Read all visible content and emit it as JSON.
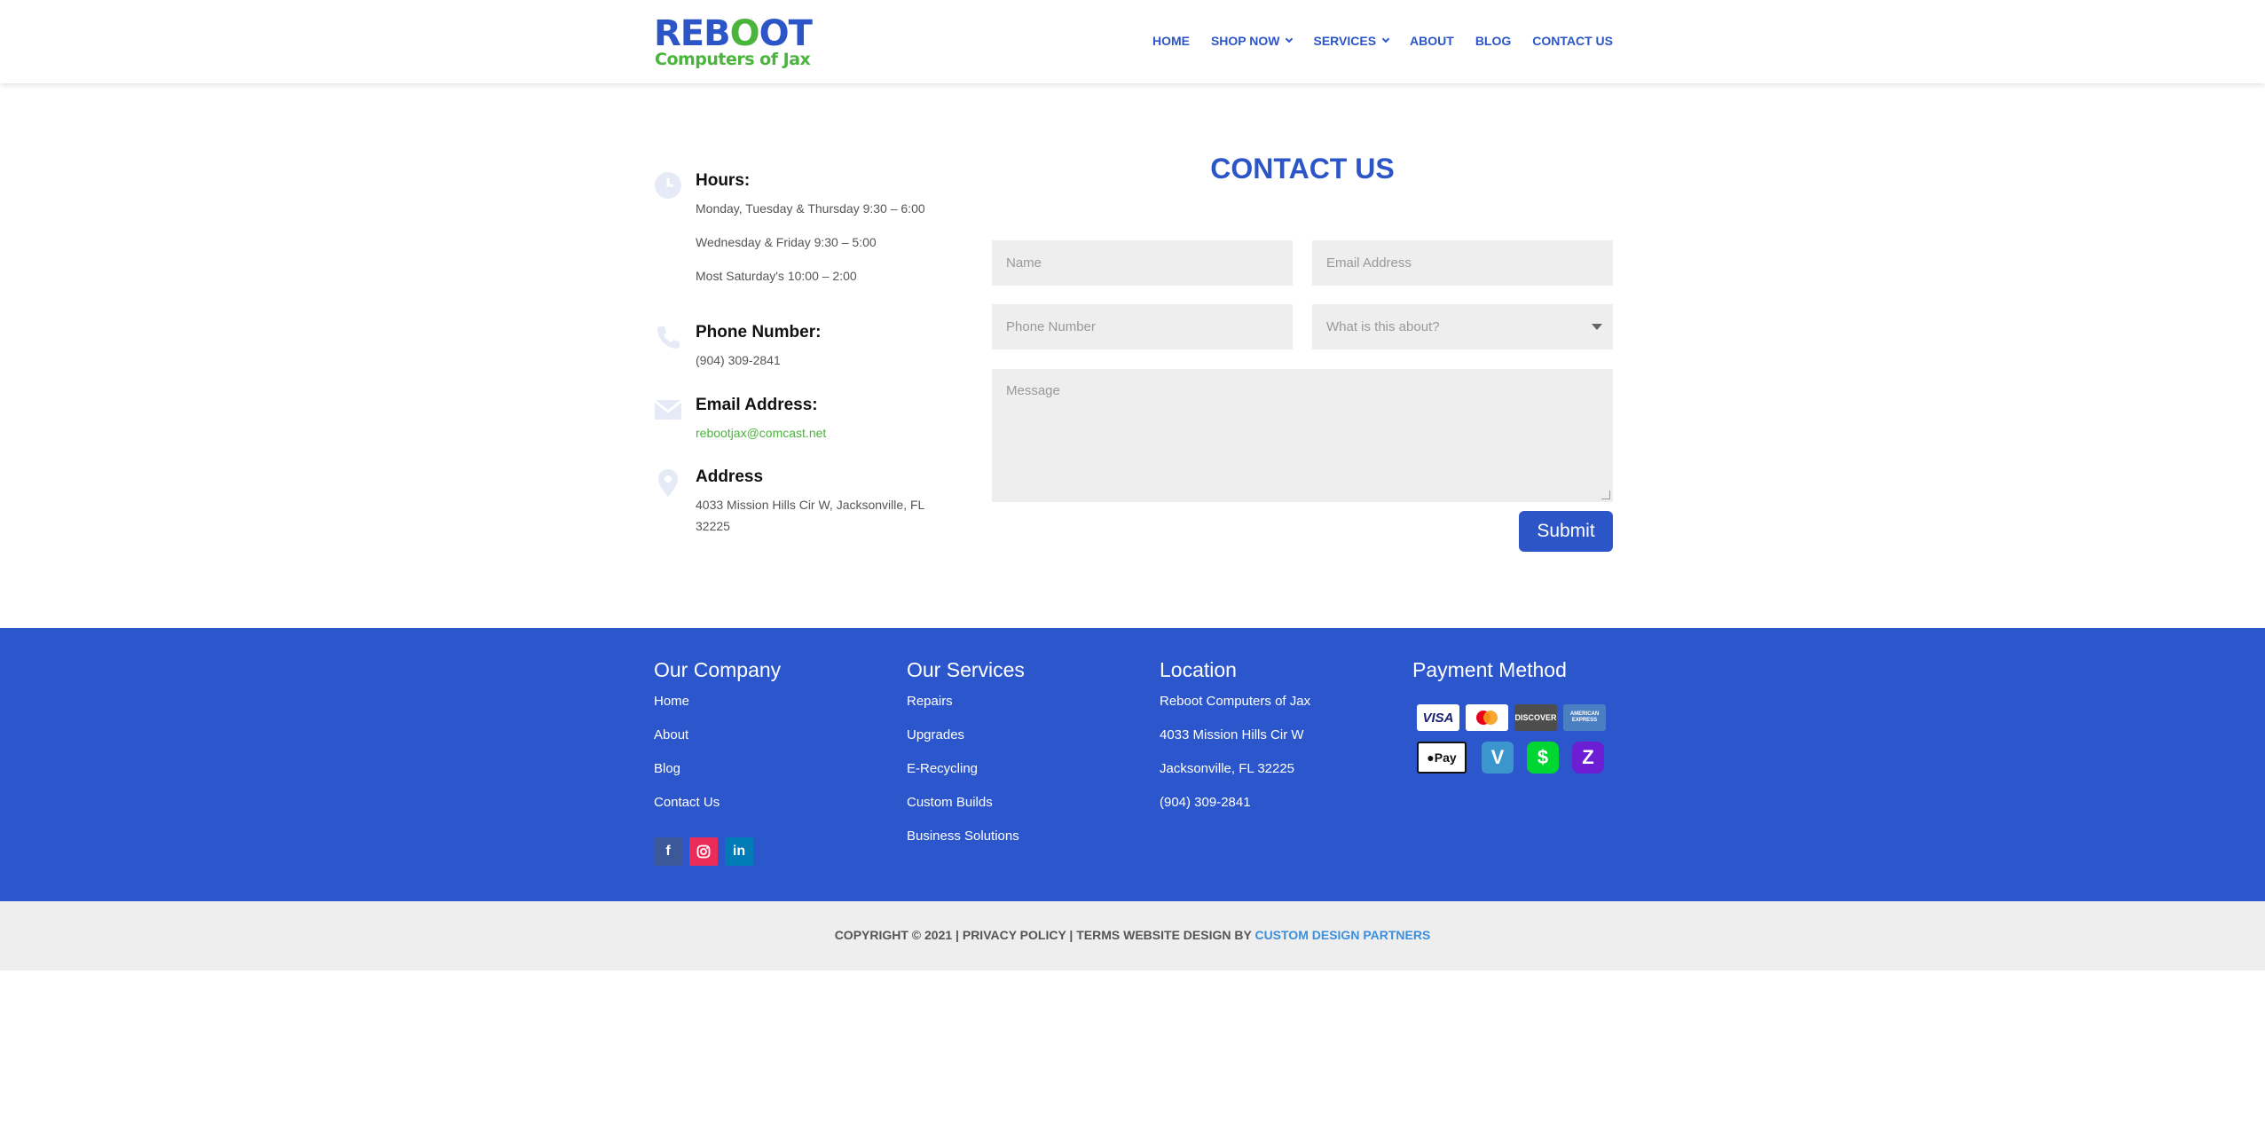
{
  "header": {
    "logo": {
      "line1": "REBOOT",
      "line2": "Computers of Jax"
    },
    "nav": [
      {
        "label": "HOME"
      },
      {
        "label": "SHOP NOW",
        "dropdown": true
      },
      {
        "label": "SERVICES",
        "dropdown": true
      },
      {
        "label": "ABOUT"
      },
      {
        "label": "BLOG"
      },
      {
        "label": "CONTACT US"
      }
    ]
  },
  "info": {
    "hours": {
      "title": "Hours:",
      "lines": [
        "Monday, Tuesday & Thursday 9:30 – 6:00",
        "Wednesday & Friday 9:30 – 5:00",
        "Most Saturday's 10:00 – 2:00"
      ],
      "icon": "clock-icon"
    },
    "phone": {
      "title": "Phone Number:",
      "value": "(904) 309-2841",
      "icon": "phone-icon"
    },
    "email": {
      "title": "Email Address:",
      "value": "rebootjax@comcast.net",
      "icon": "envelope-icon"
    },
    "address": {
      "title": "Address",
      "line1": "4033 Mission Hills Cir W, Jacksonville, FL",
      "line2": "32225",
      "icon": "map-pin-icon"
    }
  },
  "form": {
    "title": "CONTACT US",
    "name_placeholder": "Name",
    "email_placeholder": "Email Address",
    "phone_placeholder": "Phone Number",
    "topic_placeholder": "What is this about?",
    "message_placeholder": "Message",
    "submit_label": "Submit"
  },
  "footer": {
    "company": {
      "heading": "Our Company",
      "links": [
        "Home",
        "About",
        "Blog",
        "Contact Us"
      ]
    },
    "services": {
      "heading": "Our Services",
      "links": [
        "Repairs",
        "Upgrades",
        "E-Recycling",
        "Custom Builds",
        "Business Solutions"
      ]
    },
    "location": {
      "heading": "Location",
      "lines": [
        "Reboot Computers of Jax",
        "4033 Mission Hills Cir W",
        "Jacksonville, FL 32225",
        "(904) 309-2841"
      ]
    },
    "payment": {
      "heading": "Payment Method",
      "methods": [
        "VISA",
        "mastercard",
        "DISCOVER",
        "AMERICAN EXPRESS",
        "Pay",
        "V",
        "$",
        "Z"
      ]
    },
    "social": [
      "f",
      "instagram-icon",
      "in"
    ]
  },
  "bottom": {
    "copyright_text": "COPYRIGHT © 2021 | PRIVACY POLICY | TERMS WEBSITE DESIGN BY ",
    "designer": "CUSTOM DESIGN PARTNERS"
  },
  "colors": {
    "brand_blue": "#2c56c8",
    "brand_green": "#4ab43c",
    "footer_bg": "#2c57cc",
    "bottom_bg": "#eeeeee"
  }
}
